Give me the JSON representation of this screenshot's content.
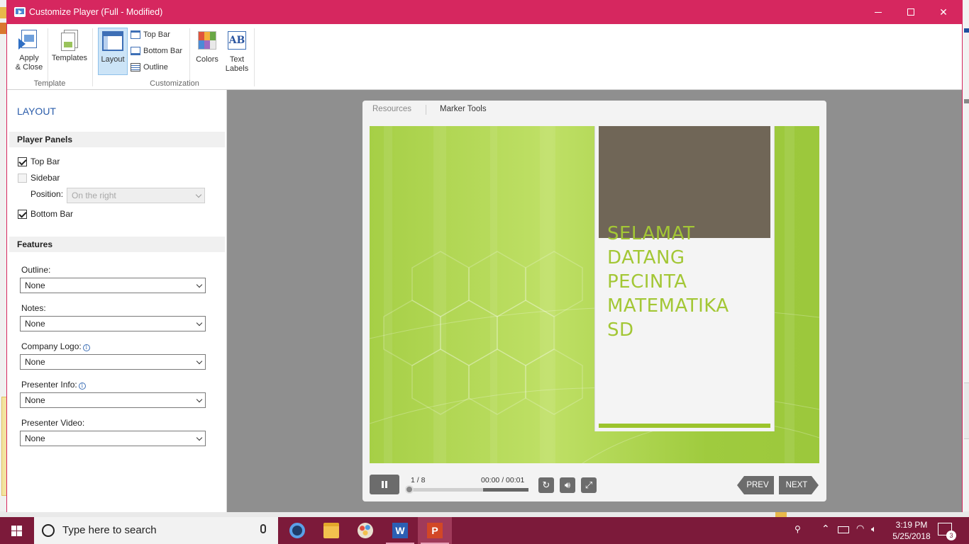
{
  "window": {
    "title": "Customize Player (Full - Modified)"
  },
  "ribbon": {
    "apply_label_1": "Apply",
    "apply_label_2": "& Close",
    "templates_label": "Templates",
    "layout_label": "Layout",
    "top_bar_label": "Top Bar",
    "bottom_bar_label": "Bottom Bar",
    "outline_label": "Outline",
    "colors_label": "Colors",
    "text_labels_1": "Text",
    "text_labels_2": "Labels",
    "group_template": "Template",
    "group_customization": "Customization",
    "text_icon": "AB"
  },
  "panel": {
    "title": "LAYOUT",
    "player_panels_heading": "Player Panels",
    "top_bar": {
      "label": "Top Bar",
      "checked": true
    },
    "sidebar": {
      "label": "Sidebar",
      "checked": false
    },
    "position_label": "Position:",
    "position_value": "On the right",
    "bottom_bar": {
      "label": "Bottom Bar",
      "checked": true
    },
    "features_heading": "Features",
    "fields": [
      {
        "label": "Outline:",
        "value": "None"
      },
      {
        "label": "Notes:",
        "value": "None"
      },
      {
        "label": "Company Logo:",
        "value": "None"
      },
      {
        "label": "Presenter Info:",
        "value": "None"
      },
      {
        "label": "Presenter Video:",
        "value": "None"
      }
    ]
  },
  "player": {
    "tab_resources": "Resources",
    "tab_marker_tools": "Marker Tools",
    "slide_heading_lines": [
      "SELAMAT",
      "DATANG",
      "PECINTA",
      "MATEMATIKA",
      "SD"
    ],
    "slide_counter": "1 / 8",
    "time": "00:00  / 00:01",
    "progress_fraction": 0.0,
    "prev_label": "PREV",
    "next_label": "NEXT"
  },
  "taskbar": {
    "search_placeholder": "Type here to search",
    "time": "3:19 PM",
    "date": "5/25/2018",
    "notification_count": "3"
  },
  "colors": {
    "title_bar": "#d6275f",
    "taskbar": "#7c1a3a",
    "accent_blue": "#2a5caa",
    "slide_green": "#a3c735"
  }
}
